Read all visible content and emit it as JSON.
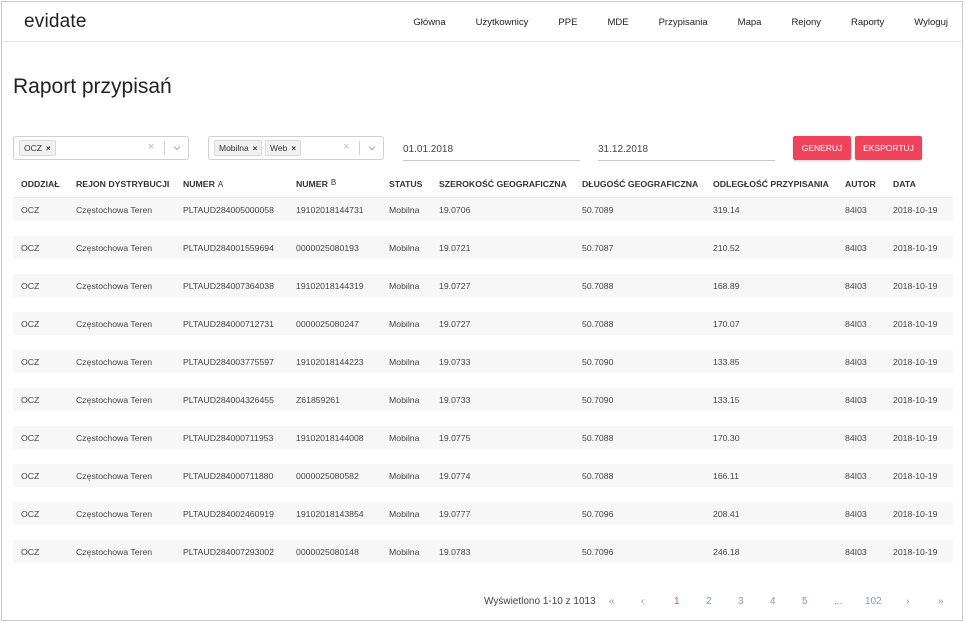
{
  "header": {
    "logo": "evidate",
    "nav": [
      "Główna",
      "Użytkownicy",
      "PPE",
      "MDE",
      "Przypisania",
      "Mapa",
      "Rejony",
      "Raporty",
      "Wyloguj"
    ]
  },
  "page": {
    "title": "Raport przypisań"
  },
  "filters": {
    "oddzial": {
      "chips": [
        "OCZ"
      ]
    },
    "status": {
      "chips": [
        "Mobilna",
        "Web"
      ]
    },
    "date_from": "01.01.2018",
    "date_to": "31.12.2018",
    "generate_label": "GENERUJ",
    "export_label": "EKSPORTUJ"
  },
  "table": {
    "columns": [
      "ODDZIAŁ",
      "REJON DYSTRYBUCJI",
      "NUMER",
      "NUMER",
      "STATUS",
      "SZEROKOŚĆ GEOGRAFICZNA",
      "DŁUGOŚĆ GEOGRAFICZNA",
      "ODLEGŁOŚĆ PRZYPISANIA",
      "AUTOR",
      "DATA"
    ],
    "sort_marks": {
      "numer_a": "A",
      "numer_b": "B"
    },
    "rows": [
      [
        "OCZ",
        "Częstochowa Teren",
        "PLTAUD284005000058",
        "19102018144731",
        "Mobilna",
        "19.0706",
        "50.7089",
        "319.14",
        "84I03",
        "2018-10-19"
      ],
      [
        "OCZ",
        "Częstochowa Teren",
        "PLTAUD284001559694",
        "0000025080193",
        "Mobilna",
        "19.0721",
        "50.7087",
        "210.52",
        "84I03",
        "2018-10-19"
      ],
      [
        "OCZ",
        "Częstochowa Teren",
        "PLTAUD284007364038",
        "19102018144319",
        "Mobilna",
        "19.0727",
        "50.7088",
        "168.89",
        "84I03",
        "2018-10-19"
      ],
      [
        "OCZ",
        "Częstochowa Teren",
        "PLTAUD284000712731",
        "0000025080247",
        "Mobilna",
        "19.0727",
        "50.7088",
        "170.07",
        "84I03",
        "2018-10-19"
      ],
      [
        "OCZ",
        "Częstochowa Teren",
        "PLTAUD284003775597",
        "19102018144223",
        "Mobilna",
        "19.0733",
        "50.7090",
        "133.85",
        "84I03",
        "2018-10-19"
      ],
      [
        "OCZ",
        "Częstochowa Teren",
        "PLTAUD284004326455",
        "Z61859261",
        "Mobilna",
        "19.0733",
        "50.7090",
        "133.15",
        "84I03",
        "2018-10-19"
      ],
      [
        "OCZ",
        "Częstochowa Teren",
        "PLTAUD284000711953",
        "19102018144008",
        "Mobilna",
        "19.0775",
        "50.7088",
        "170.30",
        "84I03",
        "2018-10-19"
      ],
      [
        "OCZ",
        "Częstochowa Teren",
        "PLTAUD284000711880",
        "0000025080582",
        "Mobilna",
        "19.0774",
        "50.7088",
        "166.11",
        "84I03",
        "2018-10-19"
      ],
      [
        "OCZ",
        "Częstochowa Teren",
        "PLTAUD284002460919",
        "19102018143854",
        "Mobilna",
        "19.0777",
        "50.7096",
        "208.41",
        "84I03",
        "2018-10-19"
      ],
      [
        "OCZ",
        "Częstochowa Teren",
        "PLTAUD284007293002",
        "0000025080148",
        "Mobilna",
        "19.0783",
        "50.7096",
        "246.18",
        "84I03",
        "2018-10-19"
      ]
    ]
  },
  "pagination": {
    "info": "Wyświetlono 1-10 z 1013",
    "first": "«",
    "prev": "‹",
    "pages": [
      "1",
      "2",
      "3",
      "4",
      "5"
    ],
    "ellipsis": "...",
    "last_page": "102",
    "next": "›",
    "last": "»",
    "active_page": "1"
  },
  "colors": {
    "accent": "#f0425a",
    "pager": "#8a93b8",
    "row_stripe": "#f7f7f7"
  }
}
